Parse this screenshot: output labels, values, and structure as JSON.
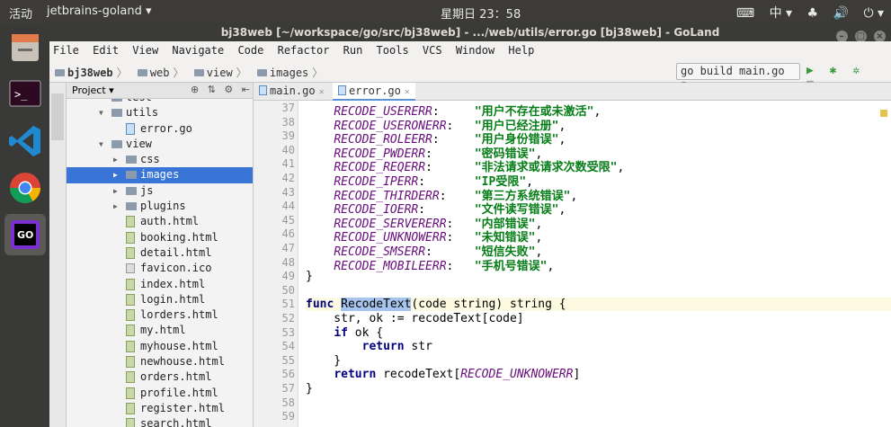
{
  "topbar": {
    "activities": "活动",
    "app_menu": "jetbrains-goland ▾",
    "clock": "星期日 23：58",
    "tray": [
      "⌨",
      "中 ▾",
      "♣",
      "🔊",
      "⏻ ▾"
    ]
  },
  "launcher": {
    "apps": [
      "files",
      "terminal",
      "vscode",
      "chrome",
      "goland"
    ]
  },
  "window": {
    "title": "bj38web [~/workspace/go/src/bj38web] - .../web/utils/error.go [bj38web] - GoLand"
  },
  "menu": [
    "File",
    "Edit",
    "View",
    "Navigate",
    "Code",
    "Refactor",
    "Run",
    "Tools",
    "VCS",
    "Window",
    "Help"
  ],
  "breadcrumb": [
    "bj38web",
    "web",
    "view",
    "images"
  ],
  "run_config": "go build main.go ▾",
  "project_panel": {
    "title": "Project ▾",
    "tree": [
      {
        "label": "test",
        "depth": 2,
        "kind": "folder",
        "arrow": ""
      },
      {
        "label": "utils",
        "depth": 2,
        "kind": "folder",
        "arrow": "▼"
      },
      {
        "label": "error.go",
        "depth": 3,
        "kind": "go",
        "arrow": ""
      },
      {
        "label": "view",
        "depth": 2,
        "kind": "folder",
        "arrow": "▼"
      },
      {
        "label": "css",
        "depth": 3,
        "kind": "folder",
        "arrow": "▶"
      },
      {
        "label": "images",
        "depth": 3,
        "kind": "folder",
        "arrow": "▶",
        "selected": true
      },
      {
        "label": "js",
        "depth": 3,
        "kind": "folder",
        "arrow": "▶"
      },
      {
        "label": "plugins",
        "depth": 3,
        "kind": "folder",
        "arrow": "▶"
      },
      {
        "label": "auth.html",
        "depth": 3,
        "kind": "html",
        "arrow": ""
      },
      {
        "label": "booking.html",
        "depth": 3,
        "kind": "html",
        "arrow": ""
      },
      {
        "label": "detail.html",
        "depth": 3,
        "kind": "html",
        "arrow": ""
      },
      {
        "label": "favicon.ico",
        "depth": 3,
        "kind": "ico",
        "arrow": ""
      },
      {
        "label": "index.html",
        "depth": 3,
        "kind": "html",
        "arrow": ""
      },
      {
        "label": "login.html",
        "depth": 3,
        "kind": "html",
        "arrow": ""
      },
      {
        "label": "lorders.html",
        "depth": 3,
        "kind": "html",
        "arrow": ""
      },
      {
        "label": "my.html",
        "depth": 3,
        "kind": "html",
        "arrow": ""
      },
      {
        "label": "myhouse.html",
        "depth": 3,
        "kind": "html",
        "arrow": ""
      },
      {
        "label": "newhouse.html",
        "depth": 3,
        "kind": "html",
        "arrow": ""
      },
      {
        "label": "orders.html",
        "depth": 3,
        "kind": "html",
        "arrow": ""
      },
      {
        "label": "profile.html",
        "depth": 3,
        "kind": "html",
        "arrow": ""
      },
      {
        "label": "register.html",
        "depth": 3,
        "kind": "html",
        "arrow": ""
      },
      {
        "label": "search.html",
        "depth": 3,
        "kind": "html",
        "arrow": ""
      }
    ]
  },
  "tabs": [
    {
      "label": "main.go",
      "active": false
    },
    {
      "label": "error.go",
      "active": true
    }
  ],
  "code": {
    "line_numbers": [
      "37",
      "38",
      "39",
      "40",
      "41",
      "42",
      "43",
      "44",
      "45",
      "46",
      "47",
      "48",
      "49",
      "50",
      "51",
      "52",
      "53",
      "54",
      "55",
      "56",
      "57",
      "58",
      "59"
    ],
    "error_map": [
      {
        "name": "RECODE_USERERR",
        "msg": "\"用户不存在或未激活\""
      },
      {
        "name": "RECODE_USERONERR",
        "msg": "\"用户已经注册\""
      },
      {
        "name": "RECODE_ROLEERR",
        "msg": "\"用户身份错误\""
      },
      {
        "name": "RECODE_PWDERR",
        "msg": "\"密码错误\""
      },
      {
        "name": "RECODE_REQERR",
        "msg": "\"非法请求或请求次数受限\""
      },
      {
        "name": "RECODE_IPERR",
        "msg": "\"IP受限\""
      },
      {
        "name": "RECODE_THIRDERR",
        "msg": "\"第三方系统错误\""
      },
      {
        "name": "RECODE_IOERR",
        "msg": "\"文件读写错误\""
      },
      {
        "name": "RECODE_SERVERERR",
        "msg": "\"内部错误\""
      },
      {
        "name": "RECODE_UNKNOWERR",
        "msg": "\"未知错误\""
      },
      {
        "name": "RECODE_SMSERR",
        "msg": "\"短信失败\""
      },
      {
        "name": "RECODE_MOBILEERR",
        "msg": "\"手机号错误\""
      }
    ],
    "close_brace": "}",
    "func_kw": "func",
    "func_name": "RecodeText",
    "func_sig": "(code string) string {",
    "line52": "    str, ok := recodeText[code]",
    "if_kw": "if",
    "line53_rest": " ok {",
    "return_kw": "return",
    "line54_rest": " str",
    "line55": "    }",
    "line56_pre": " recodeText[",
    "line56_const": "RECODE_UNKNOWERR",
    "line56_post": "]",
    "line57": "}"
  }
}
